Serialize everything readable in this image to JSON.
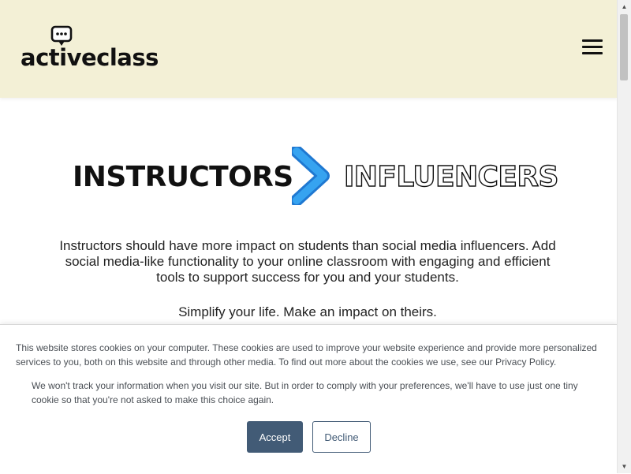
{
  "header": {
    "logo_text": "activeclass",
    "logo_icon": "chat-bubble-icon",
    "menu_icon": "hamburger-menu-icon",
    "background": "#f3f0d6"
  },
  "hero": {
    "left_word": "INSTRUCTORS",
    "right_word": "INFLUENCERS",
    "arrow_icon": "chevron-right-icon",
    "arrow_color": "#2f9be8"
  },
  "intro": {
    "paragraph": "Instructors should have more impact on students than social media influencers.  Add social media-like functionality to your online classroom with engaging and efficient tools to support success for you and your students.",
    "tagline": "Simplify your life. Make an impact on theirs."
  },
  "cookie_banner": {
    "notice": "This website stores cookies on your computer. These cookies are used to improve your website experience and provide more personalized services to you, both on this website and through other media. To find out more about the cookies we use, see our Privacy Policy.",
    "opt_out_notice": "We won't track your information when you visit our site. But in order to comply with your preferences, we'll have to use just one tiny cookie so that you're not asked to make this choice again.",
    "accept_label": "Accept",
    "decline_label": "Decline",
    "accent_color": "#425b76"
  }
}
